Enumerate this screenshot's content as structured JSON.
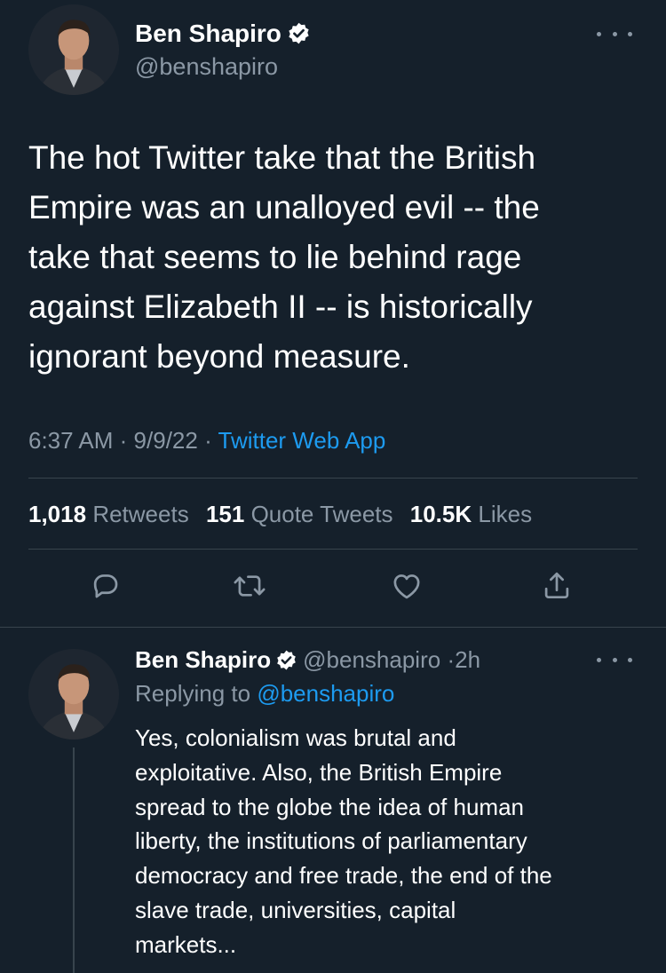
{
  "tweet": {
    "author_name": "Ben Shapiro",
    "author_handle": "@benshapiro",
    "text_lines": [
      "The hot Twitter take that the British",
      "Empire was an unalloyed evil -- the",
      "take that seems to lie behind rage",
      "against Elizabeth II -- is historically",
      "ignorant beyond measure."
    ],
    "time": "6:37 AM",
    "date": "9/9/22",
    "separator": "·",
    "source_app": "Twitter Web App",
    "retweets_count": "1,018",
    "retweets_label": "Retweets",
    "quotes_count": "151",
    "quotes_label": "Quote Tweets",
    "likes_count": "10.5K",
    "likes_label": "Likes"
  },
  "actions": {
    "icons": [
      "reply-icon",
      "retweet-icon",
      "like-icon",
      "share-icon"
    ]
  },
  "reply": {
    "author_name": "Ben Shapiro",
    "author_handle": "@benshapiro",
    "time_ago": "2h",
    "separator": "·",
    "replying_prefix": "Replying to",
    "replying_to": "@benshapiro",
    "text_lines": [
      "Yes, colonialism was brutal and",
      "exploitative. Also, the British Empire",
      "spread to the globe the idea of human",
      "liberty, the institutions of parliamentary",
      "democracy and free trade, the end of the",
      "slave trade, universities, capital",
      "markets..."
    ]
  },
  "colors": {
    "background": "#15202b",
    "text_primary": "#ffffff",
    "text_secondary": "#8b98a5",
    "accent": "#1d9bf0",
    "divider": "#38444d"
  }
}
